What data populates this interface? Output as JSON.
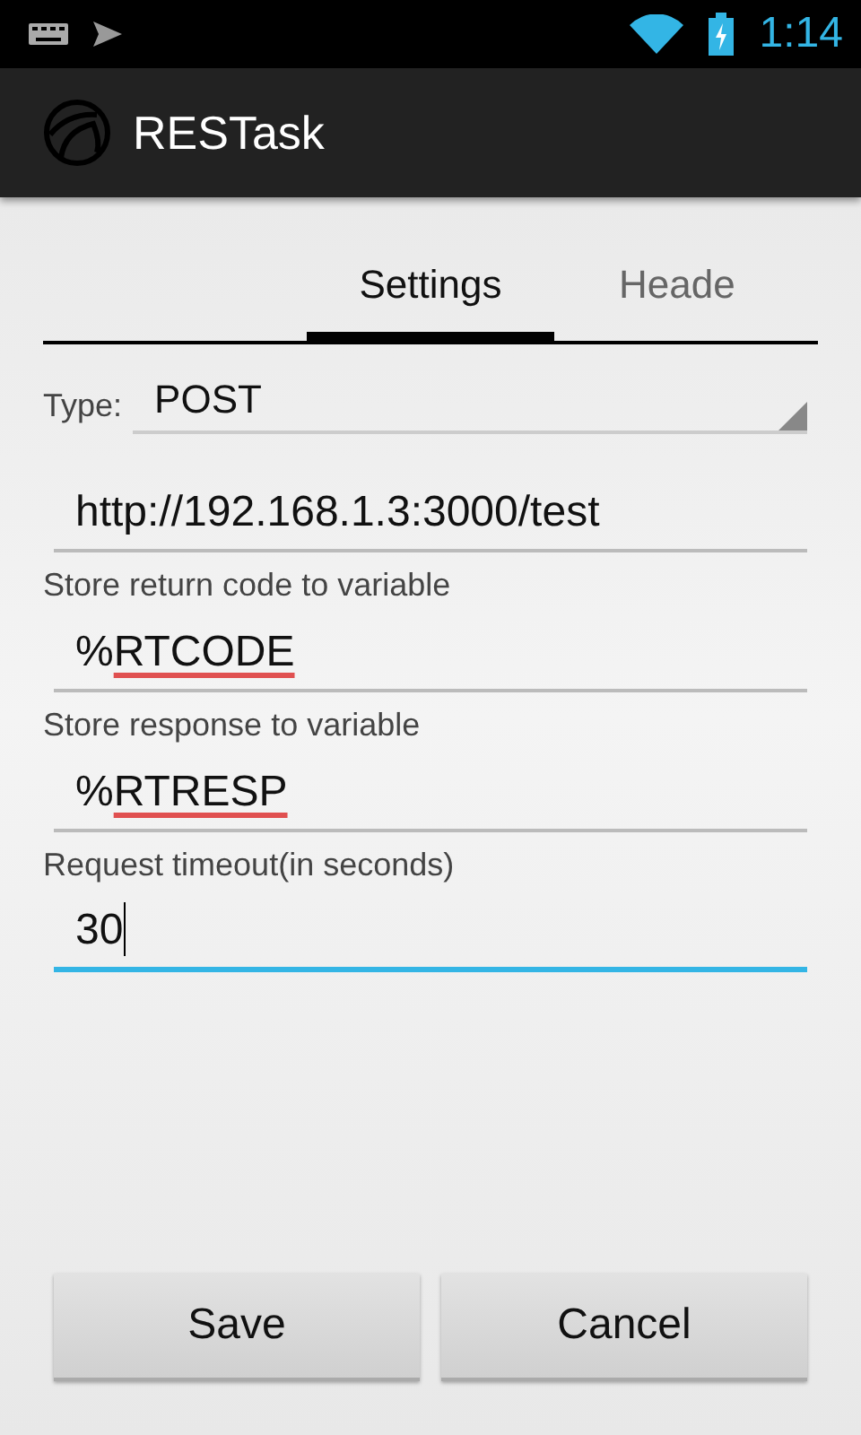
{
  "status_bar": {
    "time": "1:14"
  },
  "action_bar": {
    "title": "RESTask"
  },
  "tabs": [
    {
      "label": "Settings",
      "selected": true
    },
    {
      "label": "Heade",
      "selected": false
    }
  ],
  "type_spinner": {
    "label": "Type:",
    "value": "POST"
  },
  "fields": [
    {
      "value": "http://192.168.1.3:3000/test",
      "spell_error": false,
      "focused": false
    },
    {
      "label": "Store return code to variable",
      "value": "%RTCODE",
      "spell_error": true,
      "focused": false
    },
    {
      "label": "Store response to variable",
      "value": "%RTRESP",
      "spell_error": true,
      "focused": false
    },
    {
      "label": "Request timeout(in seconds)",
      "value": "30",
      "spell_error": false,
      "focused": true
    }
  ],
  "buttons": [
    {
      "label": "Save"
    },
    {
      "label": "Cancel"
    }
  ]
}
